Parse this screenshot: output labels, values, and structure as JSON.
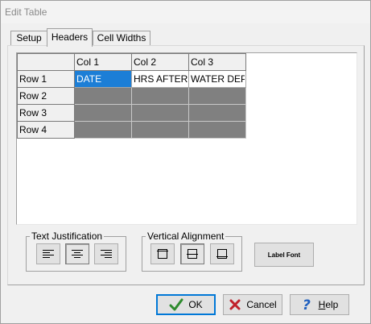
{
  "window": {
    "title": "Edit Table"
  },
  "tabs": [
    {
      "label": "Setup"
    },
    {
      "label": "Headers"
    },
    {
      "label": "Cell Widths"
    }
  ],
  "grid": {
    "columns": [
      "Col 1",
      "Col 2",
      "Col 3"
    ],
    "rows": [
      "Row 1",
      "Row 2",
      "Row 3",
      "Row 4"
    ],
    "row1": [
      "DATE",
      "HRS AFTER CAL",
      "WATER DEPTH"
    ],
    "selected_cell": "row1.col1"
  },
  "text_justification": {
    "label": "Text Justification",
    "options": [
      "align-left",
      "align-center",
      "align-right"
    ],
    "selected": "align-center"
  },
  "vertical_alignment": {
    "label": "Vertical Alignment",
    "options": [
      "align-top",
      "align-middle",
      "align-bottom"
    ],
    "selected": "align-middle"
  },
  "label_font_button": "Label Font",
  "footer": {
    "ok": "OK",
    "cancel": "Cancel",
    "help": "Help"
  },
  "colors": {
    "selection": "#1c7ed6",
    "disabled_cell": "#808080",
    "ok_check": "#2e8b2e",
    "cancel_x": "#c0202a",
    "help_q": "#1f5fbf"
  }
}
